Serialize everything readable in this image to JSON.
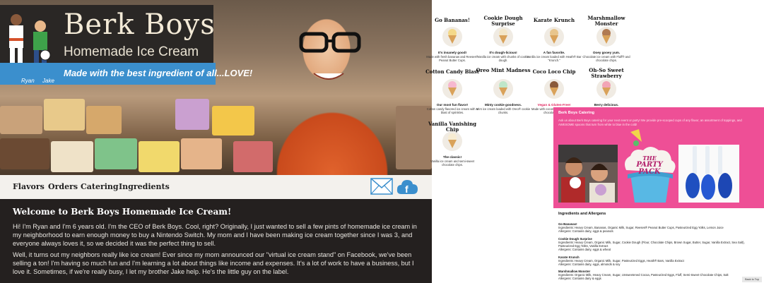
{
  "brand": {
    "title": "Berk Boys",
    "subtitle": "Homemade Ice Cream",
    "tagline": "Made with the best ingredient of all...LOVE!",
    "name_left": "Ryan",
    "name_right": "Jake"
  },
  "nav": {
    "items": [
      {
        "label": "Flavors"
      },
      {
        "label": "Orders"
      },
      {
        "label": "Catering"
      },
      {
        "label": "Ingredients"
      }
    ]
  },
  "intro": {
    "heading": "Welcome to Berk Boys Homemade Ice Cream!",
    "p1": "Hi! I'm Ryan and I'm 6 years old. I'm the CEO of Berk Boys. Cool, right? Originally, I just wanted to sell a few pints of homemade ice cream in my neighborhood to earn enough money to buy a Nintendo Switch. My mom and I have been making ice cream together since I was 3, and everyone always loves it, so we decided it was the perfect thing to sell.",
    "p2": "Well, it turns out my neighbors really like ice cream! Ever since my mom announced our \"virtual ice cream stand\" on Facebook, we've been selling a ton! I'm having so much fun and I'm learning a lot about things like income and expenses. It's a lot of work to have a business, but I love it. Sometimes, if we're really busy, I let my brother Jake help. He's the little guy on the label."
  },
  "flavors": [
    {
      "name": "Go Bananas!",
      "tag": "It's insanely good!",
      "desc": "Made with fresh bananas and Reeses® Peanut Butter Cups.",
      "color": "#f4d98a"
    },
    {
      "name": "Cookie Dough Surprise",
      "tag": "It's dough-licious!",
      "desc": "Vanilla ice cream with chunks of cookie dough.",
      "color": "#f3e6c8"
    },
    {
      "name": "Karate Krunch",
      "tag": "A fan favorite.",
      "desc": "Vanilla ice cream loaded with Heath® Bar \"Krunch.\"",
      "color": "#e8c58c"
    },
    {
      "name": "Marshmallow Monster",
      "tag": "Ooey gooey yum.",
      "desc": "Chocolate ice cream with Fluff® and chocolate chips.",
      "color": "#b07a52"
    },
    {
      "name": "Cotton Candy Blast",
      "tag": "Our most fun flavor!",
      "desc": "Cotton candy flavored ice cream with a blast of sprinkles.",
      "color": "#f6b8cf"
    },
    {
      "name": "Oreo Mint Madness",
      "tag": "Minty cookie goodness.",
      "desc": "Mint ice cream loaded with Oreo® cookie chunks.",
      "color": "#bfe6c9"
    },
    {
      "name": "Coco Loco Chip",
      "tag": "Vegan & Gluten-Free!",
      "desc": "Made with coconut milk and vegan chocolate chips.",
      "color": "#8a5a3a"
    },
    {
      "name": "Oh-So Sweet Strawberry",
      "tag": "Berry delicious.",
      "desc": "",
      "color": "#f2a5b5"
    },
    {
      "name": "Vanilla Vanishing Chip",
      "tag": "The classic!",
      "desc": "Vanilla ice cream and semi-sweet chocolate chips.",
      "color": "#f7ecd2"
    }
  ],
  "catering": {
    "title": "Berk Boys Catering",
    "text": "Ask us about Berk Boys catering for your next event or party! We provide pre-scooped cups of any flavor, an assortment of toppings, and AWESOME spoons that turn from white to blue in the cold!",
    "party_line1": "THE",
    "party_line2": "PARTY",
    "party_line3": "PACK"
  },
  "ingredients": {
    "title": "Ingredients and Allergens",
    "items": [
      {
        "name": "Go Bananas!",
        "ingredients": "Ingredients: Heavy Cream, Bananas, Organic Milk, Sugar, Reeses® Peanut Butter Cups, Pasteurized Egg Yolks, Lemon Juice",
        "allergens": "Allergens: Contains dairy, eggs & peanuts"
      },
      {
        "name": "Cookie Dough Surprise",
        "ingredients": "Ingredients: Heavy Cream, Organic Milk, Sugar, Cookie Dough (Flour, Chocolate Chips, Brown Sugar, Butter, Sugar, Vanilla Extract, Sea Salt), Pasteurized Egg Yolks, Vanilla Extract",
        "allergens": "Allergens: Contains dairy, eggs & wheat"
      },
      {
        "name": "Karate Krunch",
        "ingredients": "Ingredients: Heavy Cream, Organic Milk, Sugar, Pasteurized Eggs, Heath® Bars, Vanilla Extract",
        "allergens": "Allergens: Contains dairy, eggs, almonds & soy"
      },
      {
        "name": "Marshmallow Monster",
        "ingredients": "Ingredients: Organic Milk, Heavy Cream, Sugar, Unsweetened Cocoa, Pasteurized Eggs, Fluff, Semi-Sweet Chocolate Chips, Salt",
        "allergens": "Allergens: Contains dairy & eggs"
      }
    ],
    "back_to_top": "Back to Top"
  }
}
